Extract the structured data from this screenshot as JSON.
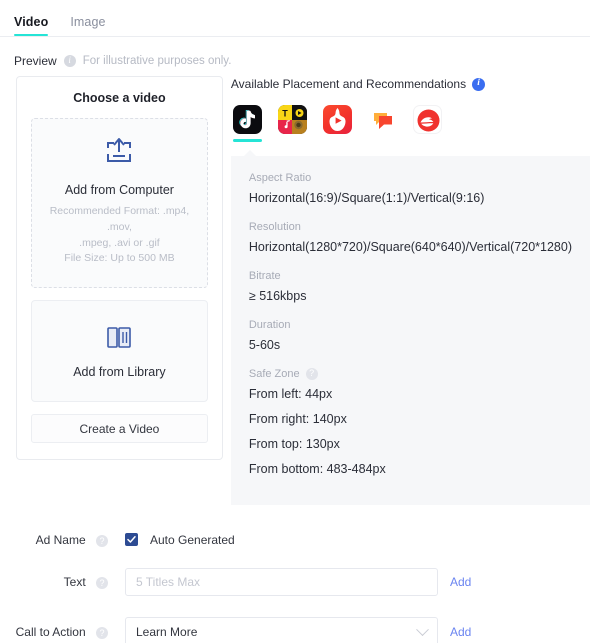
{
  "tabs": [
    {
      "label": "Video",
      "active": true
    },
    {
      "label": "Image",
      "active": false
    }
  ],
  "preview": {
    "label": "Preview",
    "note": "For illustrative purposes only.",
    "info_icon": "info-icon"
  },
  "video_card": {
    "title": "Choose a video",
    "dropzone": {
      "icon": "upload-icon",
      "title": "Add from Computer",
      "recommended_format": "Recommended Format: .mp4, .mov,",
      "recommended_format_2": ".mpeg, .avi or .gif",
      "file_size": "File Size: Up to 500 MB"
    },
    "library": {
      "icon": "library-icon",
      "title": "Add from Library"
    },
    "create_button": "Create a Video"
  },
  "placement": {
    "heading": "Available Placement and Recommendations",
    "info_icon": "info-icon-blue",
    "apps": [
      {
        "name": "tiktok",
        "selected": true
      },
      {
        "name": "news-feed-apps",
        "selected": false
      },
      {
        "name": "helo",
        "selected": false
      },
      {
        "name": "topbuzz",
        "selected": false
      },
      {
        "name": "babe",
        "selected": false
      }
    ]
  },
  "specs": [
    {
      "label": "Aspect Ratio",
      "value": "Horizontal(16:9)/Square(1:1)/Vertical(9:16)",
      "help": false
    },
    {
      "label": "Resolution",
      "value": "Horizontal(1280*720)/Square(640*640)/Vertical(720*1280)",
      "help": false
    },
    {
      "label": "Bitrate",
      "value": "≥ 516kbps",
      "help": false
    },
    {
      "label": "Duration",
      "value": "5-60s",
      "help": false
    }
  ],
  "safe_zone": {
    "label": "Safe Zone",
    "help": true,
    "values": [
      "From left: 44px",
      "From right: 140px",
      "From top: 130px",
      "From bottom: 483-484px"
    ]
  },
  "form": {
    "ad_name": {
      "label": "Ad Name",
      "help_icon": "help-icon",
      "checkbox_checked": true,
      "checkbox_label": "Auto Generated"
    },
    "text": {
      "label": "Text",
      "help_icon": "help-icon",
      "value": "",
      "placeholder": "5 Titles Max",
      "add_label": "Add"
    },
    "call_to_action": {
      "label": "Call to Action",
      "help_icon": "help-icon",
      "value": "Learn More",
      "chevron_icon": "chevron-down-icon",
      "add_label": "Add"
    }
  },
  "colors": {
    "accent": "#25e4d6",
    "link": "#6a84f0",
    "checkbox": "#2d4b93",
    "info_blue": "#3a6df0",
    "panel_bg": "#f6f7f9"
  }
}
